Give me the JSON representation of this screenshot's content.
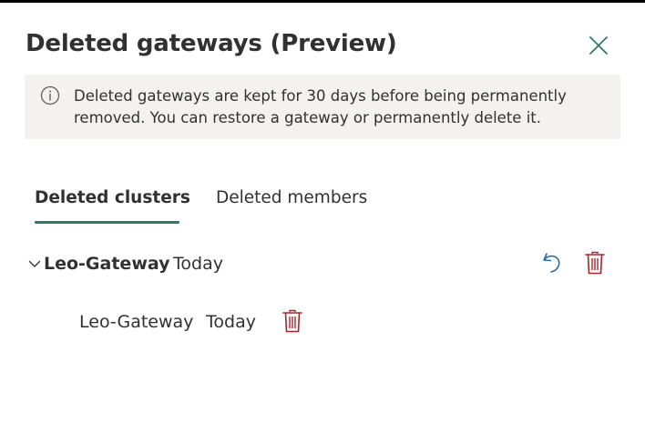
{
  "panel": {
    "title": "Deleted gateways (Preview)",
    "close_icon": "close-icon"
  },
  "info": {
    "icon": "info-icon",
    "text": "Deleted gateways are kept for 30 days before being permanently removed. You can restore a gateway or permanently delete it."
  },
  "tabs": [
    {
      "label": "Deleted clusters",
      "active": true
    },
    {
      "label": "Deleted members",
      "active": false
    }
  ],
  "clusters": [
    {
      "name": "Leo-Gateway",
      "date": "Today",
      "expanded": true,
      "members": [
        {
          "name": "Leo-Gateway",
          "date": "Today"
        }
      ]
    }
  ],
  "colors": {
    "accent": "#2f7a65",
    "restore": "#2b6cb0",
    "delete": "#a4262c",
    "info_bg": "#f3f2f1",
    "text": "#323130"
  }
}
